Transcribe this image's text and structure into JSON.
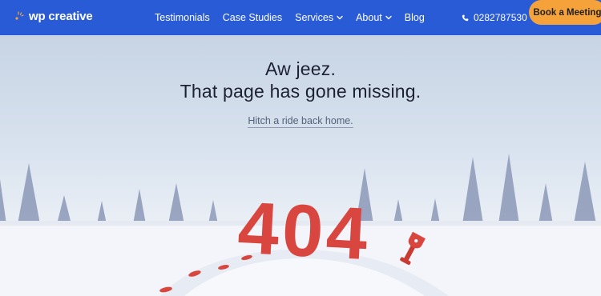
{
  "header": {
    "logo_text": "wp creative",
    "nav": [
      {
        "label": "Testimonials",
        "has_dropdown": false
      },
      {
        "label": "Case Studies",
        "has_dropdown": false
      },
      {
        "label": "Services",
        "has_dropdown": true
      },
      {
        "label": "About",
        "has_dropdown": true
      },
      {
        "label": "Blog",
        "has_dropdown": false
      }
    ],
    "phone": "0282787530",
    "cta_label": "Book a Meeting"
  },
  "hero": {
    "headline_line1": "Aw jeez.",
    "headline_line2": "That page has gone missing.",
    "link_text": "Hitch a ride back home.",
    "error_code": "404"
  },
  "colors": {
    "header_bg": "#2a5bd7",
    "cta_bg": "#f5a23a",
    "error_red": "#d9463f",
    "tree": "#8694b3"
  },
  "icons": {
    "phone": "phone-icon",
    "dropdown": "chevron-down-icon",
    "shovel": "shovel-icon"
  }
}
